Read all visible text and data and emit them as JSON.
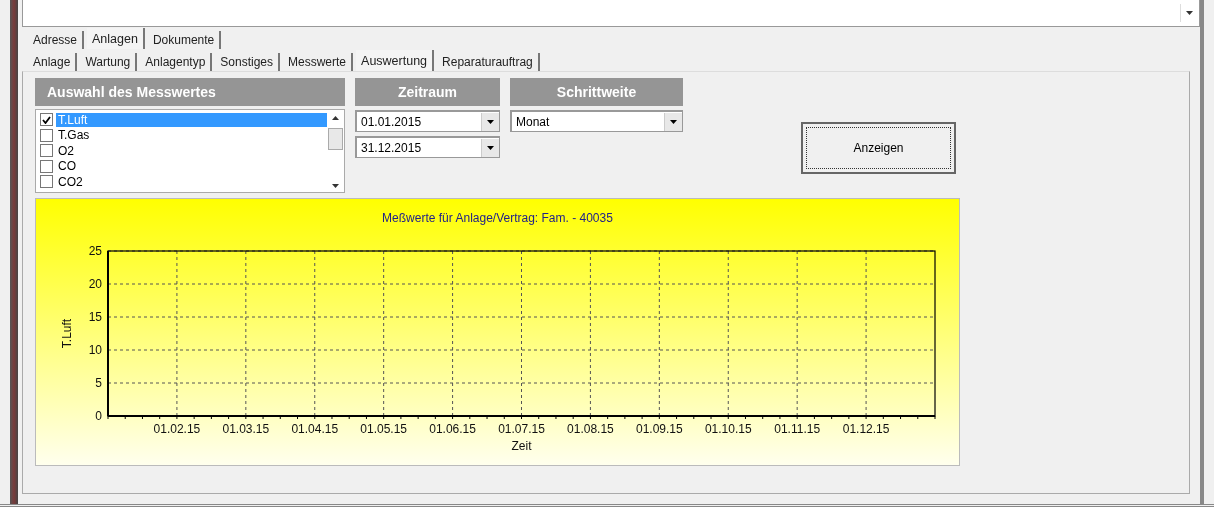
{
  "main_tabs": [
    {
      "label": "Adresse",
      "selected": false
    },
    {
      "label": "Anlagen",
      "selected": true
    },
    {
      "label": "Dokumente",
      "selected": false
    }
  ],
  "sub_tabs": [
    {
      "label": "Anlage",
      "selected": false
    },
    {
      "label": "Wartung",
      "selected": false
    },
    {
      "label": "Anlagentyp",
      "selected": false
    },
    {
      "label": "Sonstiges",
      "selected": false
    },
    {
      "label": "Messwerte",
      "selected": false
    },
    {
      "label": "Auswertung",
      "selected": true
    },
    {
      "label": "Reparaturauftrag",
      "selected": false
    }
  ],
  "measure": {
    "header": "Auswahl des Messwertes",
    "items": [
      {
        "label": "T.Luft",
        "checked": true,
        "selected": true
      },
      {
        "label": "T.Gas",
        "checked": false,
        "selected": false
      },
      {
        "label": "O2",
        "checked": false,
        "selected": false
      },
      {
        "label": "CO",
        "checked": false,
        "selected": false
      },
      {
        "label": "CO2",
        "checked": false,
        "selected": false
      }
    ]
  },
  "period": {
    "header": "Zeitraum",
    "from": "01.01.2015",
    "to": "31.12.2015"
  },
  "step": {
    "header": "Schrittweite",
    "value": "Monat"
  },
  "show_button": "Anzeigen",
  "chart": {
    "chart_data": {
      "type": "line",
      "grid": true,
      "title": "Meßwerte für Anlage/Vertrag: Fam. - 40035",
      "xlabel": "Zeit",
      "ylabel": "T.Luft",
      "ylim": [
        0,
        25
      ],
      "categories": [
        "01.02.15",
        "01.03.15",
        "01.04.15",
        "01.05.15",
        "01.06.15",
        "01.07.15",
        "01.08.15",
        "01.09.15",
        "01.10.15",
        "01.11.15",
        "01.12.15"
      ],
      "yticks": [
        0,
        5,
        10,
        15,
        20,
        25
      ]
    }
  }
}
